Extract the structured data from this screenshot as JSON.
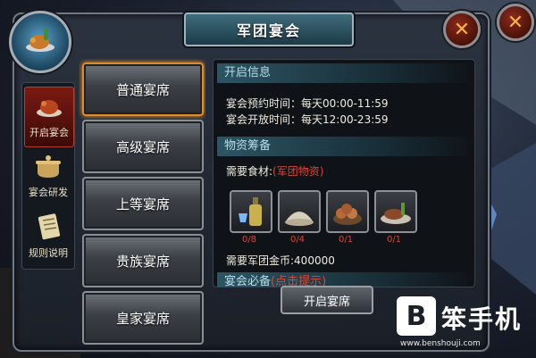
{
  "window": {
    "title": "军团宴会"
  },
  "sidebar": {
    "items": [
      {
        "label": "开启宴会",
        "icon": "roast-turkey-icon",
        "active": true
      },
      {
        "label": "宴会研发",
        "icon": "cooking-pot-icon",
        "active": false
      },
      {
        "label": "规则说明",
        "icon": "scroll-icon",
        "active": false
      }
    ]
  },
  "tiers": [
    {
      "label": "普通宴席",
      "active": true
    },
    {
      "label": "高级宴席",
      "active": false
    },
    {
      "label": "上等宴席",
      "active": false
    },
    {
      "label": "贵族宴席",
      "active": false
    },
    {
      "label": "皇家宴席",
      "active": false
    }
  ],
  "open_info": {
    "header": "开启信息",
    "reserve_label": "宴会预约时间：",
    "reserve_value": "每天00:00-11:59",
    "open_label": "宴会开放时间：",
    "open_value": "每天12:00-23:59"
  },
  "materials": {
    "header": "物资筹备",
    "need_label": "需要食材:",
    "need_source": "(军团物资)",
    "items": [
      {
        "icon": "wine-bottle-icon",
        "count": "0/8"
      },
      {
        "icon": "flour-sack-icon",
        "count": "0/4"
      },
      {
        "icon": "bread-basket-icon",
        "count": "0/1"
      },
      {
        "icon": "meat-platter-icon",
        "count": "0/1"
      }
    ],
    "gold_label": "需要军团金币:",
    "gold_value": "400000"
  },
  "required": {
    "header": "宴会必备",
    "hint": "(点击提示)"
  },
  "actions": {
    "open_label": "开启宴席"
  },
  "watermark": {
    "logo": "B",
    "name": "笨手机",
    "url": "www.benshouji.com"
  },
  "colors": {
    "accent_orange": "#e08a2a",
    "warning_red": "#d4483a",
    "header_teal": "#2c5564"
  }
}
